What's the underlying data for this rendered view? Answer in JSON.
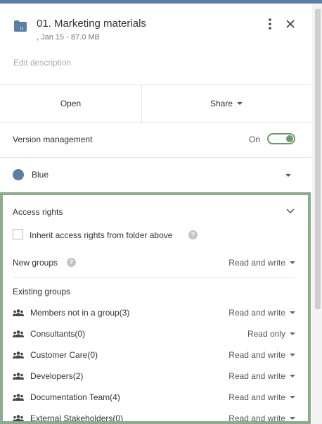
{
  "colors": {
    "topbar": "#5a7fa6",
    "accent_green": "#6b9a6b",
    "highlight_border": "#8aad8a",
    "folder_color_dot": "#5a7fa6"
  },
  "header": {
    "title": "01. Marketing materials",
    "subtitle": ", Jan 15 - 87.0 MB",
    "folder_icon_badge": "1x",
    "edit_description": "Edit description"
  },
  "actions": {
    "open_label": "Open",
    "share_label": "Share"
  },
  "version_management": {
    "label": "Version management",
    "state_label": "On",
    "enabled": true
  },
  "folder_color": {
    "label": "Blue"
  },
  "access_rights": {
    "title": "Access rights",
    "inherit_label": "Inherit access rights from folder above",
    "inherit_checked": false,
    "new_groups_label": "New groups",
    "new_groups_permission": "Read and write",
    "existing_groups_label": "Existing groups",
    "groups": [
      {
        "name": "Members not in a group(3)",
        "permission": "Read and write"
      },
      {
        "name": "Consultants(0)",
        "permission": "Read only"
      },
      {
        "name": "Customer Care(0)",
        "permission": "Read and write"
      },
      {
        "name": "Developers(2)",
        "permission": "Read and write"
      },
      {
        "name": "Documentation Team(4)",
        "permission": "Read and write"
      },
      {
        "name": "External Stakeholders(0)",
        "permission": "Read and write"
      }
    ]
  }
}
